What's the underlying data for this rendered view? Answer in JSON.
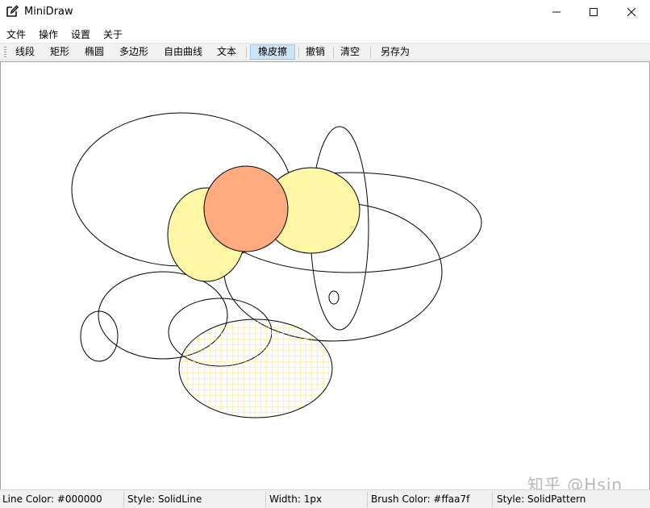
{
  "window": {
    "title": "MiniDraw",
    "app_icon": "pencil-edit-icon",
    "controls": [
      "minimize-icon",
      "maximize-icon",
      "close-icon"
    ]
  },
  "menu": {
    "items": [
      {
        "label": "文件"
      },
      {
        "label": "操作"
      },
      {
        "label": "设置"
      },
      {
        "label": "关于"
      }
    ]
  },
  "toolbar": {
    "tools": [
      {
        "label": "线段",
        "active": false
      },
      {
        "label": "矩形",
        "active": false
      },
      {
        "label": "椭圆",
        "active": false
      },
      {
        "label": "多边形",
        "active": false
      },
      {
        "label": "自由曲线",
        "active": false
      },
      {
        "label": "文本",
        "active": false
      },
      {
        "label": "橡皮擦",
        "active": true
      }
    ],
    "actions": [
      {
        "label": "撤销"
      },
      {
        "label": "清空"
      },
      {
        "label": "另存为"
      }
    ]
  },
  "canvas": {
    "colors": {
      "stroke": "#000000",
      "yellow_fill": "#fff6a6",
      "orange_fill": "#ffaa7f",
      "hatch": "#f5e27a"
    }
  },
  "watermark": "知乎 @Hsin",
  "status": {
    "line_color": "Line Color: #000000",
    "style": "Style: SolidLine",
    "width": "Width: 1px",
    "brush_color": "Brush Color: #ffaa7f",
    "brush_style": "Style: SolidPattern"
  }
}
